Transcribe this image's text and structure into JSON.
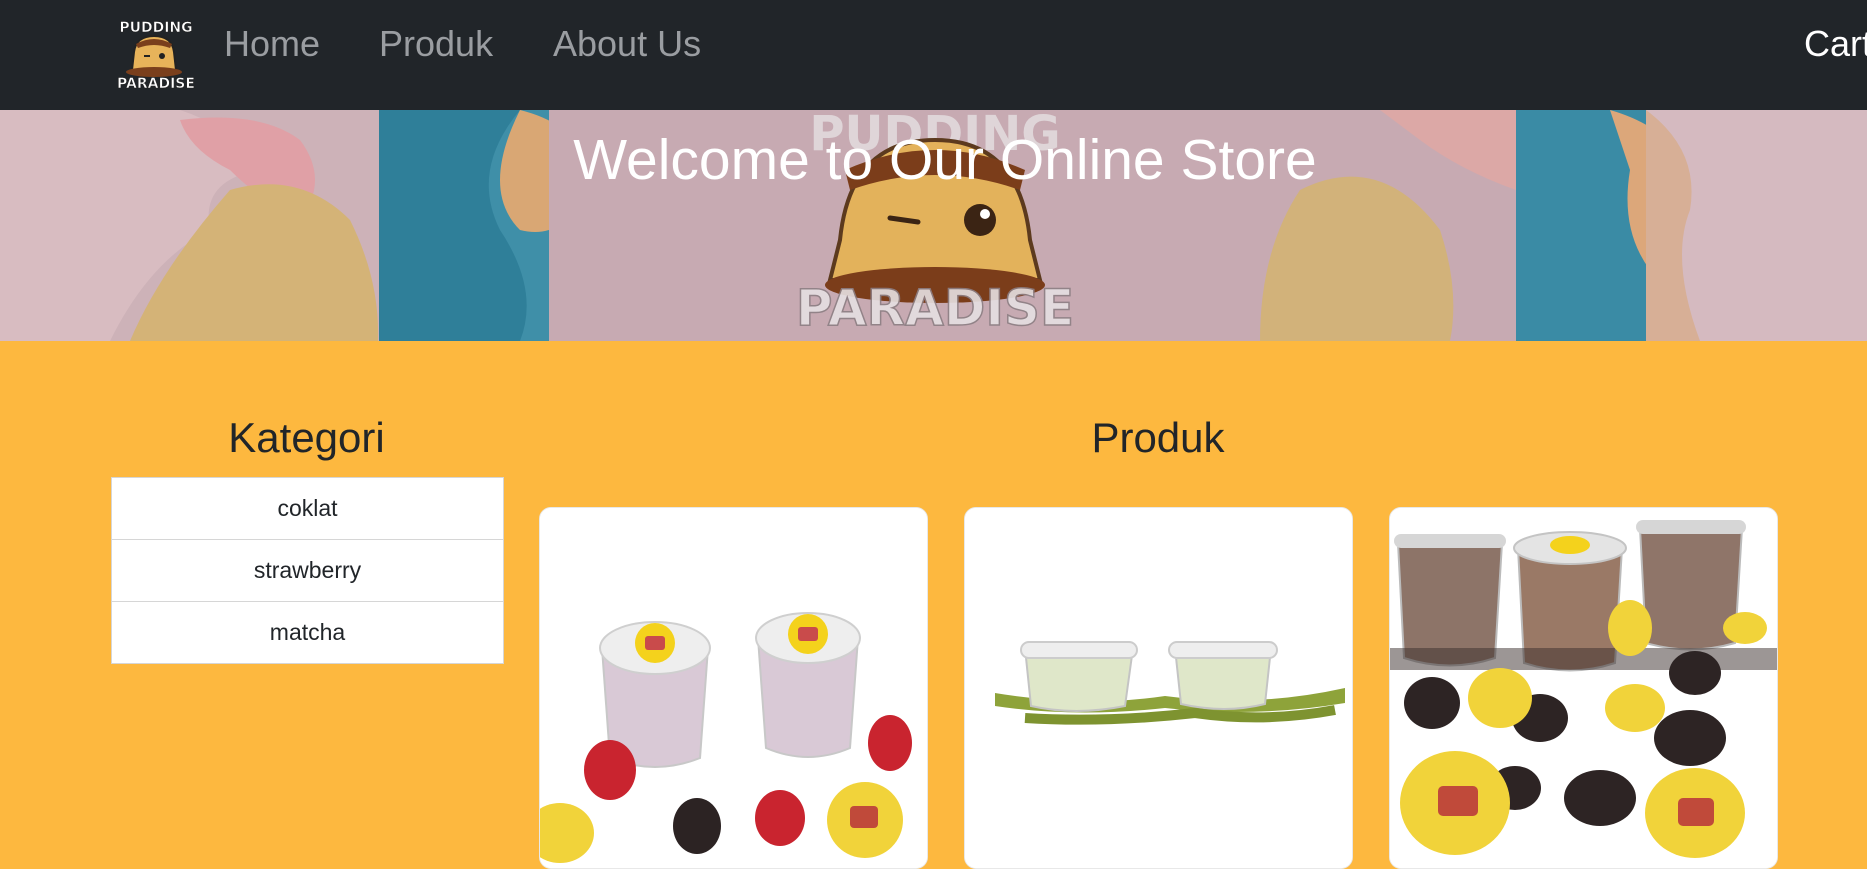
{
  "navbar": {
    "logo_alt": "Pudding Paradise logo",
    "links": [
      "Home",
      "Produk",
      "About Us"
    ],
    "cart_label": "Cart"
  },
  "hero": {
    "title": "Welcome to Our Online Store",
    "background_icon": "pudding-paradise-banner-image"
  },
  "sidebar": {
    "title": "Kategori",
    "categories": [
      "coklat",
      "strawberry",
      "matcha"
    ]
  },
  "main": {
    "title": "Produk",
    "products": [
      {
        "image": "strawberry-pudding-image"
      },
      {
        "image": "matcha-pudding-image"
      },
      {
        "image": "chocolate-oreo-pudding-image"
      }
    ]
  },
  "colors": {
    "navbar": "#212529",
    "page_background": "#FDB83F",
    "nav_link": "#9a9da1",
    "card": "#ffffff"
  }
}
